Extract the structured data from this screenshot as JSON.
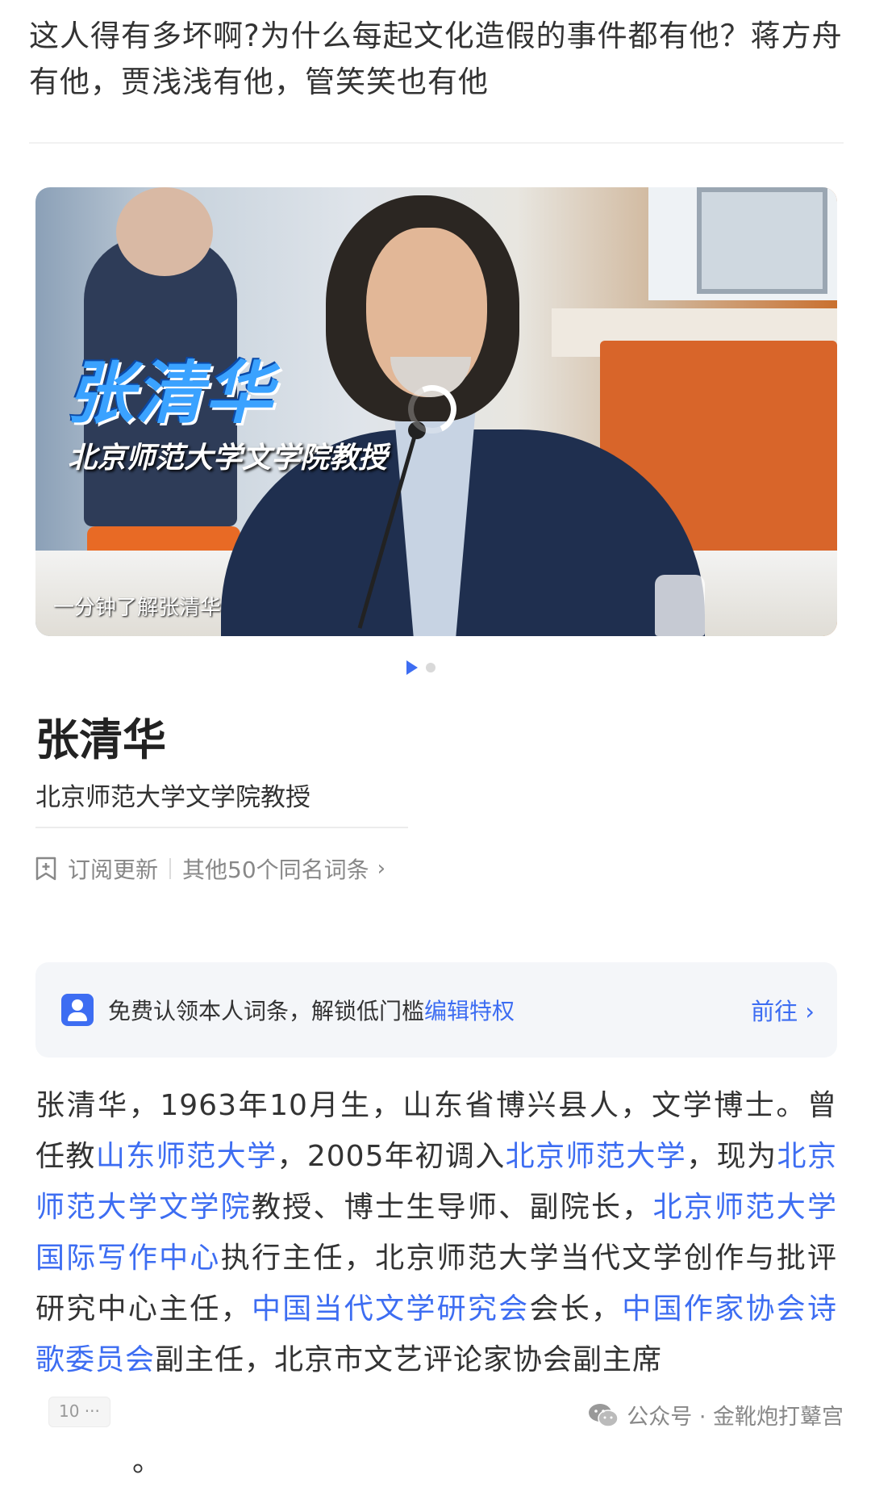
{
  "question": {
    "text": "这人得有多坏啊?为什么每起文化造假的事件都有他？蒋方舟有他，贾浅浅有他，管笑笑也有他"
  },
  "video": {
    "overlay_name": "张清华",
    "overlay_title": "北京师范大学文学院教授",
    "caption": "一分钟了解张清华",
    "loading_icon": "spinner-icon"
  },
  "pager": {
    "active_icon": "play-icon",
    "count": 2,
    "active_index": 0
  },
  "entry": {
    "title": "张清华",
    "subtitle": "北京师范大学文学院教授"
  },
  "actions": {
    "subscribe_label": "订阅更新",
    "subscribe_icon": "bookmark-plus-icon",
    "same_name_label": "其他50个同名词条",
    "chevron": "›"
  },
  "claim_banner": {
    "icon": "person-icon",
    "text": "免费认领本人词条，解锁低门槛",
    "link_text": "编辑特权",
    "go_label": "前往",
    "chevron": "›"
  },
  "body": {
    "segments": [
      {
        "text": "张清华，1963年10月生，山东省博兴县人，文学博士。曾任教",
        "link": false
      },
      {
        "text": "山东师范大学",
        "link": true
      },
      {
        "text": "，2005年初调入",
        "link": false
      },
      {
        "text": "北京师范大学",
        "link": true
      },
      {
        "text": "，现为",
        "link": false
      },
      {
        "text": "北京师范大学文学院",
        "link": true
      },
      {
        "text": "教授、博士生导师、副院长，",
        "link": false
      },
      {
        "text": "北京师范大学国际写作中心",
        "link": true
      },
      {
        "text": "执行主任，北京师范大学当代文学创作与批评研究中心主任，",
        "link": false
      },
      {
        "text": "中国当代文学研究会",
        "link": true
      },
      {
        "text": "会长，",
        "link": false
      },
      {
        "text": "中国作家协会诗歌委员会",
        "link": true
      },
      {
        "text": "副主任，北京市文艺评论家协会副主席",
        "link": false
      }
    ],
    "ref_badge": "10 ···",
    "end_mark": "。"
  },
  "watermark": {
    "icon": "wechat-icon",
    "text": "公众号 · 金靴炮打鼙宫"
  },
  "colors": {
    "link": "#3d6df2",
    "accent_name": "#3aa2ff"
  }
}
